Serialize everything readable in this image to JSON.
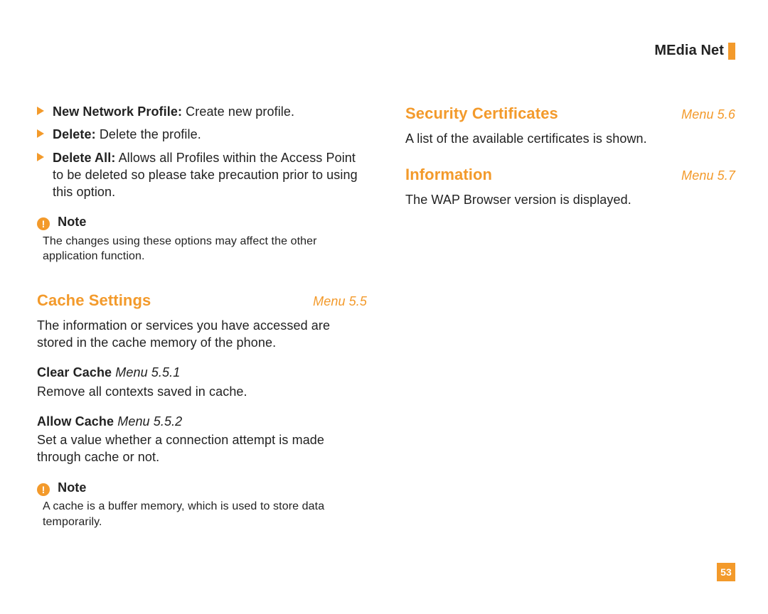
{
  "header": {
    "title": "MEdia Net"
  },
  "left": {
    "bullets": [
      {
        "label": "New Network Profile:",
        "text": " Create new profile."
      },
      {
        "label": "Delete:",
        "text": " Delete the profile."
      },
      {
        "label": "Delete All:",
        "text": " Allows all Profiles within the Access Point to be deleted so please take precaution prior to using this option."
      }
    ],
    "note1": {
      "title": "Note",
      "text": "The changes using these options may affect the other application function."
    },
    "cache": {
      "title": "Cache Settings",
      "ref": "Menu 5.5",
      "intro": "The information or services you have accessed are stored in the cache memory of the phone.",
      "sub1": {
        "title": "Clear Cache",
        "ref": "Menu 5.5.1",
        "text": "Remove all contexts saved in cache."
      },
      "sub2": {
        "title": "Allow Cache",
        "ref": "Menu 5.5.2",
        "text": "Set a value whether a connection attempt is made through cache or not."
      }
    },
    "note2": {
      "title": "Note",
      "text": "A cache is a buffer memory, which is used to store data temporarily."
    }
  },
  "right": {
    "sec": {
      "title": "Security Certificates",
      "ref": "Menu 5.6",
      "text": "A list of the available certificates is shown."
    },
    "info": {
      "title": "Information",
      "ref": "Menu 5.7",
      "text": "The WAP Browser version is displayed."
    }
  },
  "pagenum": "53"
}
